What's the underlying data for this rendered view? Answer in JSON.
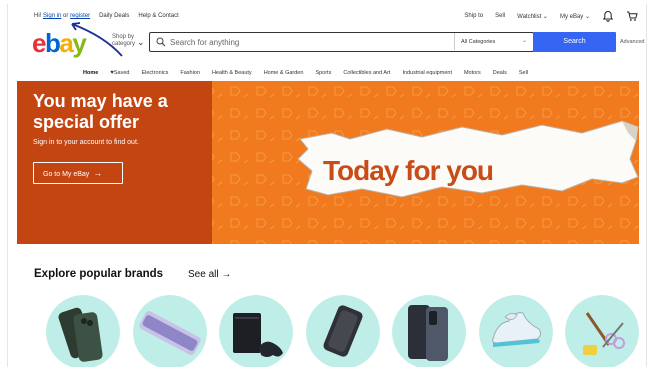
{
  "topbar": {
    "hi": "Hi!",
    "sign_in": "Sign in",
    "or": "or",
    "register": "register",
    "daily_deals": "Daily Deals",
    "help_contact": "Help & Contact",
    "ship_to": "Ship to",
    "sell": "Sell",
    "watchlist": "Watchlist",
    "my_ebay": "My eBay"
  },
  "header": {
    "logo": {
      "e": "e",
      "b": "b",
      "a": "a",
      "y": "y"
    },
    "shop_by_category": "Shop by category",
    "search_placeholder": "Search for anything",
    "category_select": "All Categories",
    "search_button": "Search",
    "advanced": "Advanced"
  },
  "nav": {
    "items": [
      "Home",
      "Saved",
      "Electronics",
      "Fashion",
      "Health & Beauty",
      "Home & Garden",
      "Sports",
      "Collectibles and Art",
      "Industrial equipment",
      "Motors",
      "Deals",
      "Sell"
    ]
  },
  "hero": {
    "title": "You may have a special offer",
    "subtitle": "Sign in to your account to find out.",
    "button": "Go to My eBay",
    "headline": "Today for you"
  },
  "brands": {
    "title": "Explore popular brands",
    "see_all": "See all"
  },
  "colors": {
    "accent_blue": "#3665f3",
    "hero_orange": "#f17a1f",
    "hero_dark": "#c34612",
    "brand_circle": "#bfeee9"
  },
  "icons": [
    "search-icon",
    "chevron-down-icon",
    "bell-icon",
    "cart-icon",
    "heart-icon",
    "arrow-right-icon"
  ]
}
